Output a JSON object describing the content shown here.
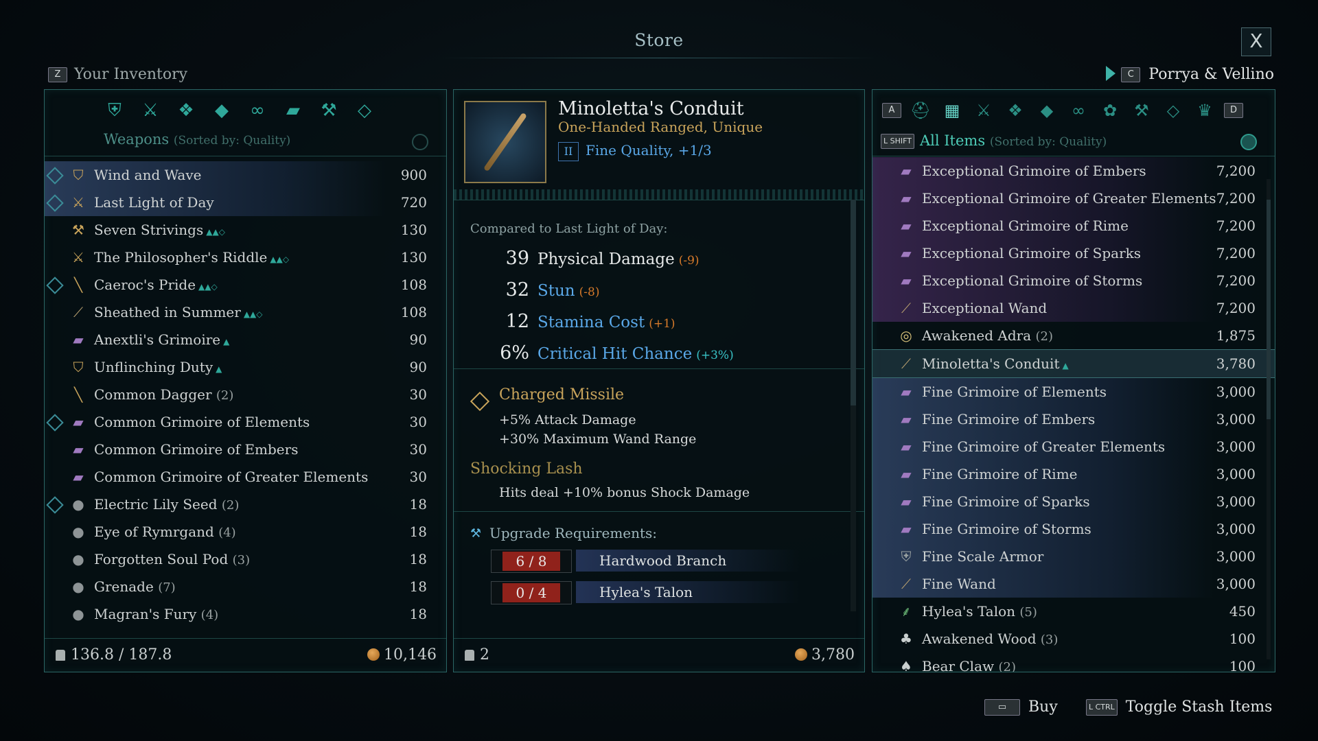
{
  "title": "Store",
  "close_label": "X",
  "inventory": {
    "key": "Z",
    "label": "Your Inventory",
    "category_icons": [
      "armor-icon",
      "weapons-icon",
      "body-icon",
      "boots-icon",
      "rings-icon",
      "grimoire-icon",
      "tools-icon",
      "gems-icon"
    ],
    "category": "Weapons",
    "sort": "(Sorted by: Quality)",
    "items": [
      {
        "name": "Wind and Wave",
        "qty": "",
        "price": "900",
        "eq": true,
        "icon": "shield-icon",
        "style": "hl"
      },
      {
        "name": "Last Light of Day",
        "qty": "",
        "price": "720",
        "eq": true,
        "icon": "sword-icon",
        "style": "hl"
      },
      {
        "name": "Seven Strivings",
        "qty": "",
        "price": "130",
        "eq": false,
        "icon": "axe-icon",
        "style": "",
        "tag": "▲▲◇"
      },
      {
        "name": "The Philosopher's Riddle",
        "qty": "",
        "price": "130",
        "eq": false,
        "icon": "sword-icon",
        "style": "",
        "tag": "▲▲◇"
      },
      {
        "name": "Caeroc's Pride",
        "qty": "",
        "price": "108",
        "eq": true,
        "icon": "dagger-icon",
        "style": "",
        "tag": "▲▲◇"
      },
      {
        "name": "Sheathed in Summer",
        "qty": "",
        "price": "108",
        "eq": false,
        "icon": "wand-icon",
        "style": "",
        "tag": "▲▲◇"
      },
      {
        "name": "Anextli's Grimoire",
        "qty": "",
        "price": "90",
        "eq": false,
        "icon": "grimoire-icon",
        "style": "",
        "tag": "▲"
      },
      {
        "name": "Unflinching Duty",
        "qty": "",
        "price": "90",
        "eq": false,
        "icon": "shield-icon",
        "style": "",
        "tag": "▲"
      },
      {
        "name": "Common Dagger",
        "qty": "(2)",
        "price": "30",
        "eq": false,
        "icon": "dagger-icon",
        "style": ""
      },
      {
        "name": "Common Grimoire of Elements",
        "qty": "",
        "price": "30",
        "eq": true,
        "icon": "grimoire-icon",
        "style": ""
      },
      {
        "name": "Common Grimoire of Embers",
        "qty": "",
        "price": "30",
        "eq": false,
        "icon": "grimoire-icon",
        "style": ""
      },
      {
        "name": "Common Grimoire of Greater Elements",
        "qty": "",
        "price": "30",
        "eq": false,
        "icon": "grimoire-icon",
        "style": ""
      },
      {
        "name": "Electric Lily Seed",
        "qty": "(2)",
        "price": "18",
        "eq": true,
        "icon": "bomb-icon",
        "style": ""
      },
      {
        "name": "Eye of Rymrgand",
        "qty": "(4)",
        "price": "18",
        "eq": false,
        "icon": "bomb-icon",
        "style": ""
      },
      {
        "name": "Forgotten Soul Pod",
        "qty": "(3)",
        "price": "18",
        "eq": false,
        "icon": "bomb-icon",
        "style": ""
      },
      {
        "name": "Grenade",
        "qty": "(7)",
        "price": "18",
        "eq": false,
        "icon": "bomb-icon",
        "style": ""
      },
      {
        "name": "Magran's Fury",
        "qty": "(4)",
        "price": "18",
        "eq": false,
        "icon": "bomb-icon",
        "style": ""
      }
    ],
    "weight": "136.8 / 187.8",
    "gold": "10,146"
  },
  "detail": {
    "name": "Minoletta's Conduit",
    "type": "One-Handed Ranged, Unique",
    "quality_badge": "II",
    "quality": "Fine Quality, +1/3",
    "compare_header": "Compared to Last Light of Day:",
    "stats": [
      {
        "value": "39",
        "label": "Physical Damage",
        "delta": "(-9)",
        "delta_class": "neg",
        "label_color": "#e6e9e9"
      },
      {
        "value": "32",
        "label": "Stun",
        "delta": "(-8)",
        "delta_class": "neg",
        "label_color": "#5aa8e8"
      },
      {
        "value": "12",
        "label": "Stamina Cost",
        "delta": "(+1)",
        "delta_class": "neg",
        "label_color": "#5aa8e8"
      },
      {
        "value": "6%",
        "label": "Critical Hit Chance",
        "delta": "(+3%)",
        "delta_class": "pos",
        "label_color": "#5aa8e8"
      }
    ],
    "perk1_title": "Charged Missile",
    "perk1_line1": "+5% Attack Damage",
    "perk1_line2": "+30% Maximum Wand Range",
    "perk2_title": "Shocking Lash",
    "perk2_line1": "Hits deal +10% bonus Shock Damage",
    "upgrade_title": "Upgrade Requirements:",
    "requirements": [
      {
        "count": "6 / 8",
        "material": "Hardwood Branch"
      },
      {
        "count": "0 / 4",
        "material": "Hylea's Talon"
      }
    ],
    "quantity": "2",
    "price": "3,780"
  },
  "merchant": {
    "key": "C",
    "name": "Porrya & Vellino",
    "tab_left_key": "A",
    "tab_right_key": "D",
    "filter_key": "L SHIFT",
    "filter": "All Items",
    "sort": "(Sorted by: Quality)",
    "items": [
      {
        "name": "Exceptional Grimoire of Embers",
        "qty": "",
        "price": "7,200",
        "icon": "grimoire-icon",
        "style": "purple"
      },
      {
        "name": "Exceptional Grimoire of Greater Elements",
        "qty": "",
        "price": "7,200",
        "icon": "grimoire-icon",
        "style": "purple"
      },
      {
        "name": "Exceptional Grimoire of Rime",
        "qty": "",
        "price": "7,200",
        "icon": "grimoire-icon",
        "style": "purple"
      },
      {
        "name": "Exceptional Grimoire of Sparks",
        "qty": "",
        "price": "7,200",
        "icon": "grimoire-icon",
        "style": "purple"
      },
      {
        "name": "Exceptional Grimoire of Storms",
        "qty": "",
        "price": "7,200",
        "icon": "grimoire-icon",
        "style": "purple"
      },
      {
        "name": "Exceptional Wand",
        "qty": "",
        "price": "7,200",
        "icon": "wand-icon",
        "style": "purple"
      },
      {
        "name": "Awakened Adra",
        "qty": "(2)",
        "price": "1,875",
        "icon": "adra-icon",
        "style": ""
      },
      {
        "name": "Minoletta's Conduit",
        "qty": "",
        "price": "3,780",
        "icon": "wand-icon",
        "style": "selected",
        "tag": "▲"
      },
      {
        "name": "Fine Grimoire of Elements",
        "qty": "",
        "price": "3,000",
        "icon": "grimoire-icon",
        "style": "hl"
      },
      {
        "name": "Fine Grimoire of Embers",
        "qty": "",
        "price": "3,000",
        "icon": "grimoire-icon",
        "style": "hl"
      },
      {
        "name": "Fine Grimoire of Greater Elements",
        "qty": "",
        "price": "3,000",
        "icon": "grimoire-icon",
        "style": "hl"
      },
      {
        "name": "Fine Grimoire of Rime",
        "qty": "",
        "price": "3,000",
        "icon": "grimoire-icon",
        "style": "hl"
      },
      {
        "name": "Fine Grimoire of Sparks",
        "qty": "",
        "price": "3,000",
        "icon": "grimoire-icon",
        "style": "hl"
      },
      {
        "name": "Fine Grimoire of Storms",
        "qty": "",
        "price": "3,000",
        "icon": "grimoire-icon",
        "style": "hl"
      },
      {
        "name": "Fine Scale Armor",
        "qty": "",
        "price": "3,000",
        "icon": "armor-icon",
        "style": "hl"
      },
      {
        "name": "Fine Wand",
        "qty": "",
        "price": "3,000",
        "icon": "wand-icon",
        "style": "hl"
      },
      {
        "name": "Hylea's Talon",
        "qty": "(5)",
        "price": "450",
        "icon": "feather-icon",
        "style": ""
      },
      {
        "name": "Awakened Wood",
        "qty": "(3)",
        "price": "100",
        "icon": "wood-icon",
        "style": ""
      },
      {
        "name": "Bear Claw",
        "qty": "(2)",
        "price": "100",
        "icon": "claw-icon",
        "style": ""
      }
    ]
  },
  "hints": {
    "buy_label": "Buy",
    "ctrl_key": "L CTRL",
    "toggle_label": "Toggle Stash Items"
  }
}
